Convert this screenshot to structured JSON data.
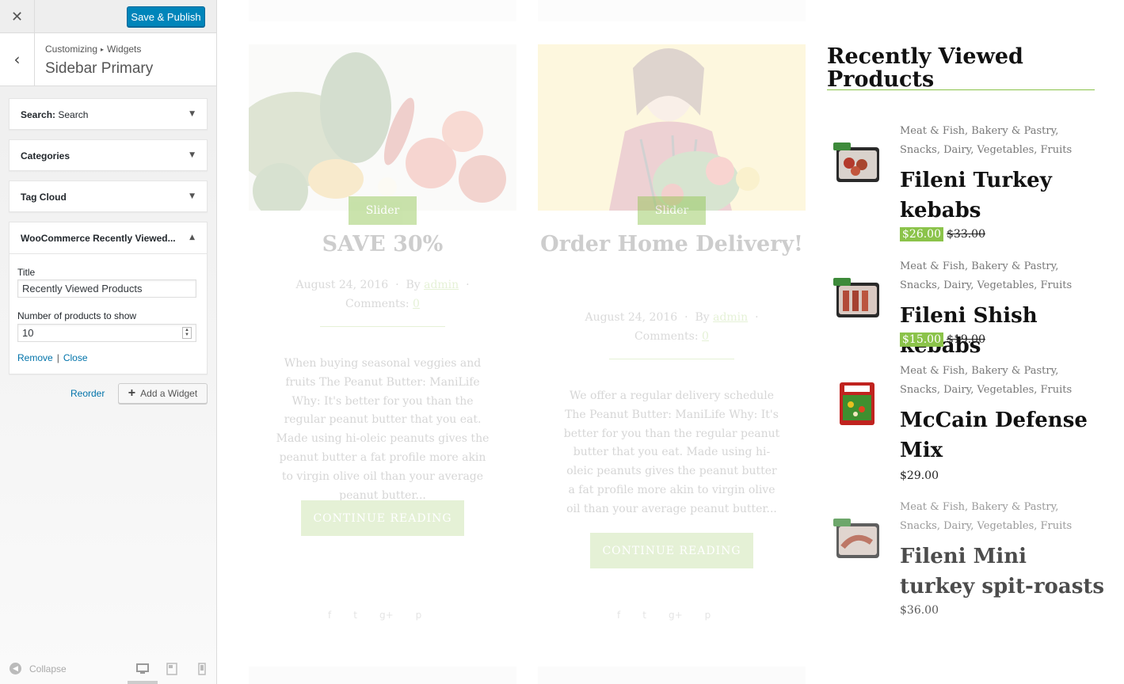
{
  "customizer": {
    "close_icon": "close-icon",
    "publish_label": "Save & Publish",
    "breadcrumb": {
      "root": "Customizing",
      "sep": "▸",
      "current": "Widgets"
    },
    "section_title": "Sidebar Primary",
    "widgets": [
      {
        "label": "Search:",
        "instance": "Search"
      },
      {
        "label": "Categories",
        "instance": ""
      },
      {
        "label": "Tag Cloud",
        "instance": ""
      },
      {
        "label": "WooCommerce Recently Viewed...",
        "instance": ""
      }
    ],
    "form": {
      "title_label": "Title",
      "title_value": "Recently Viewed Products",
      "count_label": "Number of products to show",
      "count_value": "10",
      "remove_label": "Remove",
      "close_label": "Close"
    },
    "reorder_label": "Reorder",
    "add_widget_label": "Add a Widget",
    "collapse_label": "Collapse",
    "accent_color": "#0085ba"
  },
  "preview": {
    "posts": [
      {
        "tag": "Slider",
        "title": "SAVE 30%",
        "date": "August 24, 2016",
        "by": "By",
        "author": "admin",
        "comments_label": "Comments:",
        "comments": "0",
        "excerpt": "When buying seasonal veggies and fruits The Peanut Butter: ManiLife Why: It's better for you than the regular peanut butter that you eat. Made using hi-oleic peanuts gives the peanut butter a fat profile more akin to virgin olive oil than your average peanut butter...",
        "button": "CONTINUE READING"
      },
      {
        "tag": "Slider",
        "title": "Order Home Delivery!",
        "date": "August 24, 2016",
        "by": "By",
        "author": "admin",
        "comments_label": "Comments:",
        "comments": "0",
        "excerpt": "We offer a regular delivery schedule The Peanut Butter: ManiLife Why: It's better for you than the regular peanut butter that you eat. Made using hi-oleic peanuts gives the peanut butter a fat profile more akin to virgin olive oil than your average peanut butter...",
        "button": "CONTINUE READING"
      }
    ],
    "recent": {
      "title": "Recently Viewed Products",
      "products": [
        {
          "cats": "Meat & Fish, Bakery & Pastry, Snacks, Dairy, Vegetables, Fruits",
          "name": "Fileni Turkey kebabs",
          "price": "$26.00",
          "old_price": "$33.00"
        },
        {
          "cats": "Meat & Fish, Bakery & Pastry, Snacks, Dairy, Vegetables, Fruits",
          "name": "Fileni Shish kebabs",
          "price": "$15.00",
          "old_price": "$19.00"
        },
        {
          "cats": "Meat & Fish, Bakery & Pastry, Snacks, Dairy, Vegetables, Fruits",
          "name": "McCain Defense Mix",
          "price": "$29.00",
          "old_price": ""
        },
        {
          "cats": "Meat & Fish, Bakery & Pastry, Snacks, Dairy, Vegetables, Fruits",
          "name": "Fileni Mini turkey spit-roasts",
          "price": "$36.00",
          "old_price": ""
        }
      ]
    },
    "accent_color": "#8bc34a"
  }
}
